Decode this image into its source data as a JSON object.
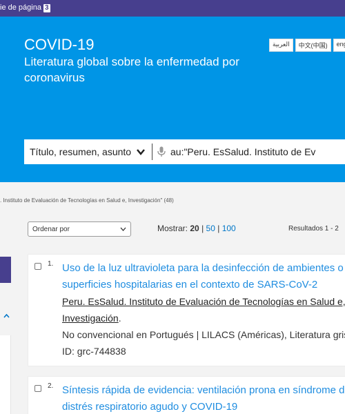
{
  "topbar": {
    "skip_label": "ie de página",
    "key": "3"
  },
  "hero": {
    "title": "COVID-19",
    "subtitle": "Literatura global sobre la enfermedad por coronavirus",
    "languages": [
      "العربية",
      "中文(中国)",
      "engl"
    ]
  },
  "search": {
    "field_label": "Título, resumen, asunto",
    "query": "au:\"Peru. EsSalud. Instituto de Ev"
  },
  "filter": {
    "breadcrumb": ". Instituto de Evaluación de Tecnologías en Salud e, Investigación\" (48)"
  },
  "controls": {
    "sort_label": "Ordenar por",
    "show_label": "Mostrar:",
    "show_current": "20",
    "show_options": [
      "50",
      "100"
    ],
    "sep": "|",
    "results_label": "Resultados 1 - 2"
  },
  "results": [
    {
      "num": "1.",
      "title": "Uso de la luz ultravioleta para la desinfección de ambientes o superficies hospitalarias en el contexto de SARS-CoV-2",
      "author": "Peru. EsSalud. Instituto de Evaluación de Tecnologías en Salud e, Investigación",
      "meta": "No convencional en Portugués | LILACS (Américas), Literatura gris | ID: grc-744838"
    },
    {
      "num": "2.",
      "title": "Síntesis rápida de evidencia: ventilación prona en síndrome de distrés respiratorio agudo y COVID-19"
    }
  ]
}
